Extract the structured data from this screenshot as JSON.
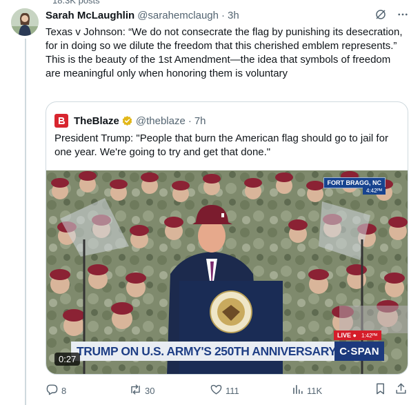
{
  "top_partial": "18.3K posts",
  "tweet": {
    "author_name": "Sarah McLaughlin",
    "author_handle": "@sarahemclaugh",
    "separator": "·",
    "time": "3h",
    "text": "Texas v Johnson: “We do not consecrate the flag by punishing its desecration, for in doing so we dilute the freedom that this cherished emblem represents.” This is the beauty of the 1st Amendment—the idea that symbols of freedom are meaningful only when honoring them is voluntary"
  },
  "quote": {
    "author_name": "TheBlaze",
    "author_handle": "@theblaze",
    "time": "7h",
    "text": "President Trump: \"People that burn the American flag should go to jail for one year. We're going to try and get that done.\"",
    "video": {
      "location": "FORT BRAGG, NC",
      "location_time": "4:42ᴾᴹ",
      "chyron": "TRUMP ON U.S. ARMY'S 250TH ANNIVERSARY",
      "live_label": "LIVE ●",
      "live_time": "1:42ᴾᴹ",
      "network": "C·SPAN",
      "duration": "0:27"
    }
  },
  "actions": {
    "replies": "8",
    "reposts": "30",
    "likes": "111",
    "views": "11K"
  },
  "icons": {
    "header": [
      "grok-slash-icon",
      "more-icon"
    ],
    "actions": [
      "reply-icon",
      "repost-icon",
      "like-icon",
      "views-icon",
      "bookmark-icon",
      "share-icon"
    ],
    "verified_color": "#e2b719"
  },
  "colors": {
    "text": "#0f1419",
    "secondary": "#536471",
    "border": "#cfd9de",
    "blaze_red": "#d8252f",
    "cspan_blue": "#1d3a7d"
  }
}
